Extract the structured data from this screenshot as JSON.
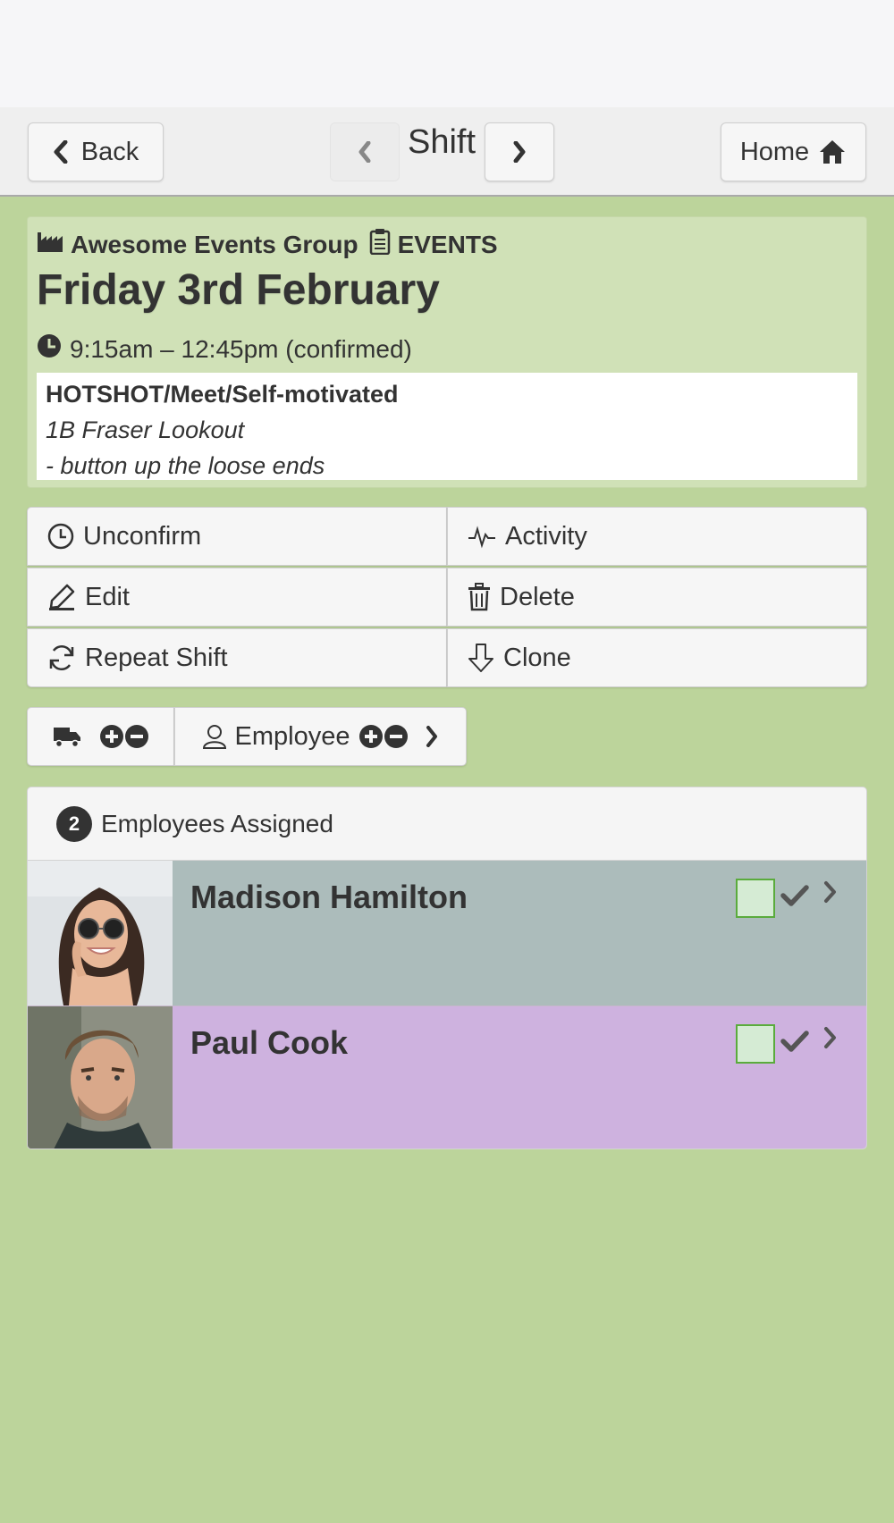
{
  "nav": {
    "back_label": "Back",
    "title": "Shift",
    "home_label": "Home"
  },
  "shift": {
    "organisation": "Awesome Events Group",
    "department": "EVENTS",
    "date": "Friday 3rd February",
    "time": "9:15am – 12:45pm (confirmed)",
    "notes": {
      "heading": "HOTSHOT/Meet/Self-motivated",
      "location": "1B Fraser Lookout",
      "task": "- button up the loose ends"
    }
  },
  "actions": {
    "unconfirm": "Unconfirm",
    "activity": "Activity",
    "edit": "Edit",
    "delete": "Delete",
    "repeat": "Repeat Shift",
    "clone": "Clone"
  },
  "assign_bar": {
    "employee_label": "Employee"
  },
  "assigned": {
    "count": "2",
    "heading": "Employees Assigned",
    "employees": [
      {
        "name": "Madison Hamilton",
        "row_color": "#acbcbb"
      },
      {
        "name": "Paul Cook",
        "row_color": "#ceb2df"
      }
    ]
  },
  "colors": {
    "page_background": "#bcd49b",
    "card_background": "#d0e1b7",
    "check_fill": "#d5ebd4",
    "check_border": "#5aab3c"
  },
  "icons": {
    "org": "factory-icon",
    "department": "clipboard-icon",
    "time": "clock-icon",
    "vehicle": "truck-icon",
    "employee": "user-icon"
  }
}
